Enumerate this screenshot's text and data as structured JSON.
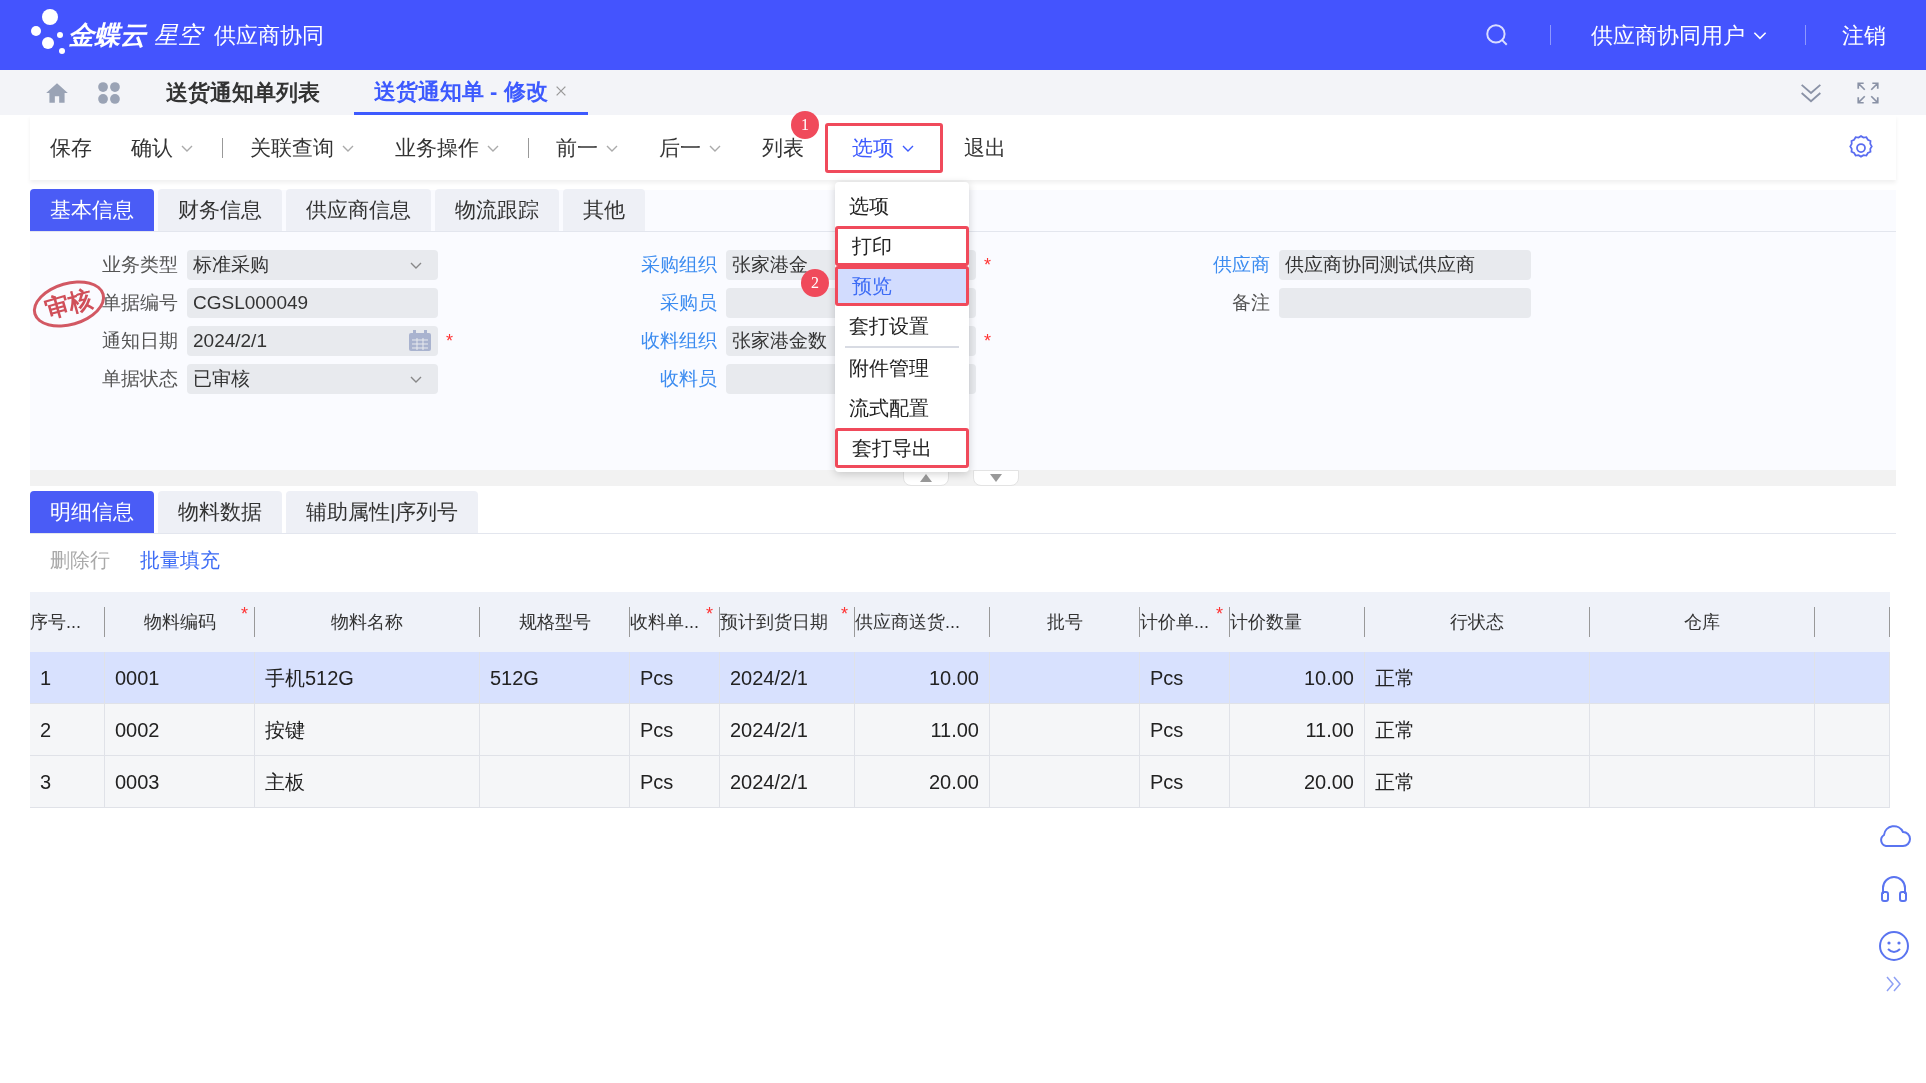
{
  "header": {
    "brand": "金蝶云",
    "product": "星空",
    "module": "供应商协同",
    "user": "供应商协同用户",
    "logout": "注销"
  },
  "page_tabs": [
    {
      "label": "送货通知单列表",
      "selected": false,
      "closable": false
    },
    {
      "label": "送货通知单 - 修改",
      "selected": true,
      "closable": true
    }
  ],
  "toolbar": [
    {
      "kind": "button",
      "label": "保存",
      "caret": false,
      "open": false,
      "highlighted": false
    },
    {
      "kind": "button",
      "label": "确认",
      "caret": true,
      "open": false,
      "highlighted": false
    },
    {
      "kind": "divider"
    },
    {
      "kind": "button",
      "label": "关联查询",
      "caret": true,
      "open": false,
      "highlighted": false
    },
    {
      "kind": "button",
      "label": "业务操作",
      "caret": true,
      "open": false,
      "highlighted": false
    },
    {
      "kind": "divider"
    },
    {
      "kind": "button",
      "label": "前一",
      "caret": true,
      "open": false,
      "highlighted": false
    },
    {
      "kind": "button",
      "label": "后一",
      "caret": true,
      "open": false,
      "highlighted": false
    },
    {
      "kind": "button",
      "label": "列表",
      "caret": false,
      "open": false,
      "highlighted": false
    },
    {
      "kind": "button",
      "label": "选项",
      "caret": true,
      "open": true,
      "highlighted": true,
      "badge": "1"
    },
    {
      "kind": "button",
      "label": "退出",
      "caret": false,
      "open": false,
      "highlighted": false
    }
  ],
  "options_menu": [
    {
      "kind": "item",
      "label": "选项",
      "selected": false,
      "highlighted": false
    },
    {
      "kind": "item",
      "label": "打印",
      "selected": false,
      "highlighted": true
    },
    {
      "kind": "item",
      "label": "预览",
      "selected": true,
      "highlighted": true,
      "badge": "2"
    },
    {
      "kind": "item",
      "label": "套打设置",
      "selected": false,
      "highlighted": false
    },
    {
      "kind": "divider"
    },
    {
      "kind": "item",
      "label": "附件管理",
      "selected": false,
      "highlighted": false
    },
    {
      "kind": "item",
      "label": "流式配置",
      "selected": false,
      "highlighted": false
    },
    {
      "kind": "item",
      "label": "套打导出",
      "selected": false,
      "highlighted": true
    }
  ],
  "form_tabs": [
    {
      "label": "基本信息",
      "selected": true
    },
    {
      "label": "财务信息",
      "selected": false
    },
    {
      "label": "供应商信息",
      "selected": false
    },
    {
      "label": "物流跟踪",
      "selected": false
    },
    {
      "label": "其他",
      "selected": false
    }
  ],
  "stamp": "审核",
  "form": {
    "columns": [
      [
        {
          "label": "业务类型",
          "value": "标准采购",
          "kind": "select",
          "link": false
        },
        {
          "label": "单据编号",
          "value": "CGSL000049",
          "kind": "text",
          "link": false
        },
        {
          "label": "通知日期",
          "value": "2024/2/1",
          "kind": "date",
          "link": false,
          "required_mark": "*"
        },
        {
          "label": "单据状态",
          "value": "已审核",
          "kind": "select",
          "link": false
        }
      ],
      [
        {
          "label": "采购组织",
          "value": "张家港金",
          "kind": "text",
          "link": true,
          "required_mark": "*"
        },
        {
          "label": "采购员",
          "kind": "text",
          "link": true
        },
        {
          "label": "收料组织",
          "value": "张家港金数",
          "kind": "text",
          "link": true,
          "required_mark": "*"
        },
        {
          "label": "收料员",
          "kind": "text",
          "link": true
        }
      ],
      [
        {
          "label": "供应商",
          "value": "供应商协同测试供应商",
          "kind": "text",
          "link": true
        },
        {
          "label": "备注",
          "kind": "text",
          "link": false
        }
      ]
    ]
  },
  "detail_tabs": [
    {
      "label": "明细信息",
      "selected": true
    },
    {
      "label": "物料数据",
      "selected": false
    },
    {
      "label": "辅助属性|序列号",
      "selected": false
    }
  ],
  "detail_actions": [
    {
      "label": "删除行",
      "disabled": true
    },
    {
      "label": "批量填充",
      "disabled": false
    }
  ],
  "table": {
    "columns": [
      {
        "label": "序号..."
      },
      {
        "label": "物料编码",
        "required_mark": "*"
      },
      {
        "label": "物料名称"
      },
      {
        "label": "规格型号"
      },
      {
        "label": "收料单...",
        "required_mark": "*"
      },
      {
        "label": "预计到货日期",
        "required_mark": "*"
      },
      {
        "label": "供应商送货..."
      },
      {
        "label": "批号"
      },
      {
        "label": "计价单...",
        "required_mark": "*"
      },
      {
        "label": "计价数量"
      },
      {
        "label": "行状态"
      },
      {
        "label": "仓库"
      },
      {}
    ],
    "rows": [
      {
        "selected": true,
        "cells": [
          "1",
          "0001",
          "手机512G",
          "512G",
          "Pcs",
          "2024/2/1",
          "10.00",
          null,
          "Pcs",
          "10.00",
          "正常",
          null,
          null
        ]
      },
      {
        "selected": false,
        "cells": [
          "2",
          "0002",
          "按键",
          null,
          "Pcs",
          "2024/2/1",
          "11.00",
          null,
          "Pcs",
          "11.00",
          "正常",
          null,
          null
        ]
      },
      {
        "selected": false,
        "cells": [
          "3",
          "0003",
          "主板",
          null,
          "Pcs",
          "2024/2/1",
          "20.00",
          null,
          "Pcs",
          "20.00",
          "正常",
          null,
          null
        ]
      }
    ]
  }
}
